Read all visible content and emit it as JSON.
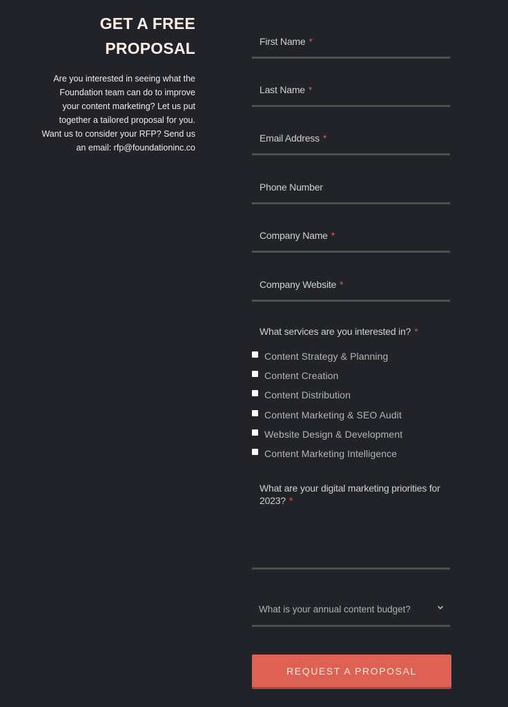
{
  "intro": {
    "title_line1": "GET A FREE",
    "title_line2": "PROPOSAL",
    "description_lines": [
      "Are you interested in seeing what the",
      "Foundation team can do to improve",
      "your content marketing? Let us put",
      "together a tailored proposal for you.",
      "Want us to consider your RFP? Send us",
      "an email: rfp@foundationinc.co"
    ]
  },
  "form": {
    "required_marker": "*",
    "fields": [
      {
        "label": "First Name",
        "required": true,
        "value": ""
      },
      {
        "label": "Last Name",
        "required": true,
        "value": ""
      },
      {
        "label": "Email Address",
        "required": true,
        "value": ""
      },
      {
        "label": "Phone Number",
        "required": false,
        "value": ""
      },
      {
        "label": "Company Name",
        "required": true,
        "value": ""
      },
      {
        "label": "Company Website",
        "required": true,
        "value": ""
      }
    ],
    "services": {
      "label": "What services are you interested in?",
      "options": [
        {
          "label": "Content Strategy & Planning",
          "checked": false
        },
        {
          "label": "Content Creation",
          "checked": false
        },
        {
          "label": "Content Distribution",
          "checked": false
        },
        {
          "label": "Content Marketing & SEO Audit",
          "checked": false
        },
        {
          "label": "Website Design & Development",
          "checked": false
        },
        {
          "label": "Content Marketing Intelligence",
          "checked": false
        }
      ]
    },
    "priorities": {
      "label": "What are your digital marketing priorities for 2023?",
      "value": ""
    },
    "budget": {
      "selected": "What is your annual content budget?",
      "icon": "chevron-down-icon"
    },
    "submit_label": "REQUEST A PROPOSAL"
  },
  "colors": {
    "background": "#212329",
    "accent": "#dd6253",
    "required": "#e0554b"
  }
}
